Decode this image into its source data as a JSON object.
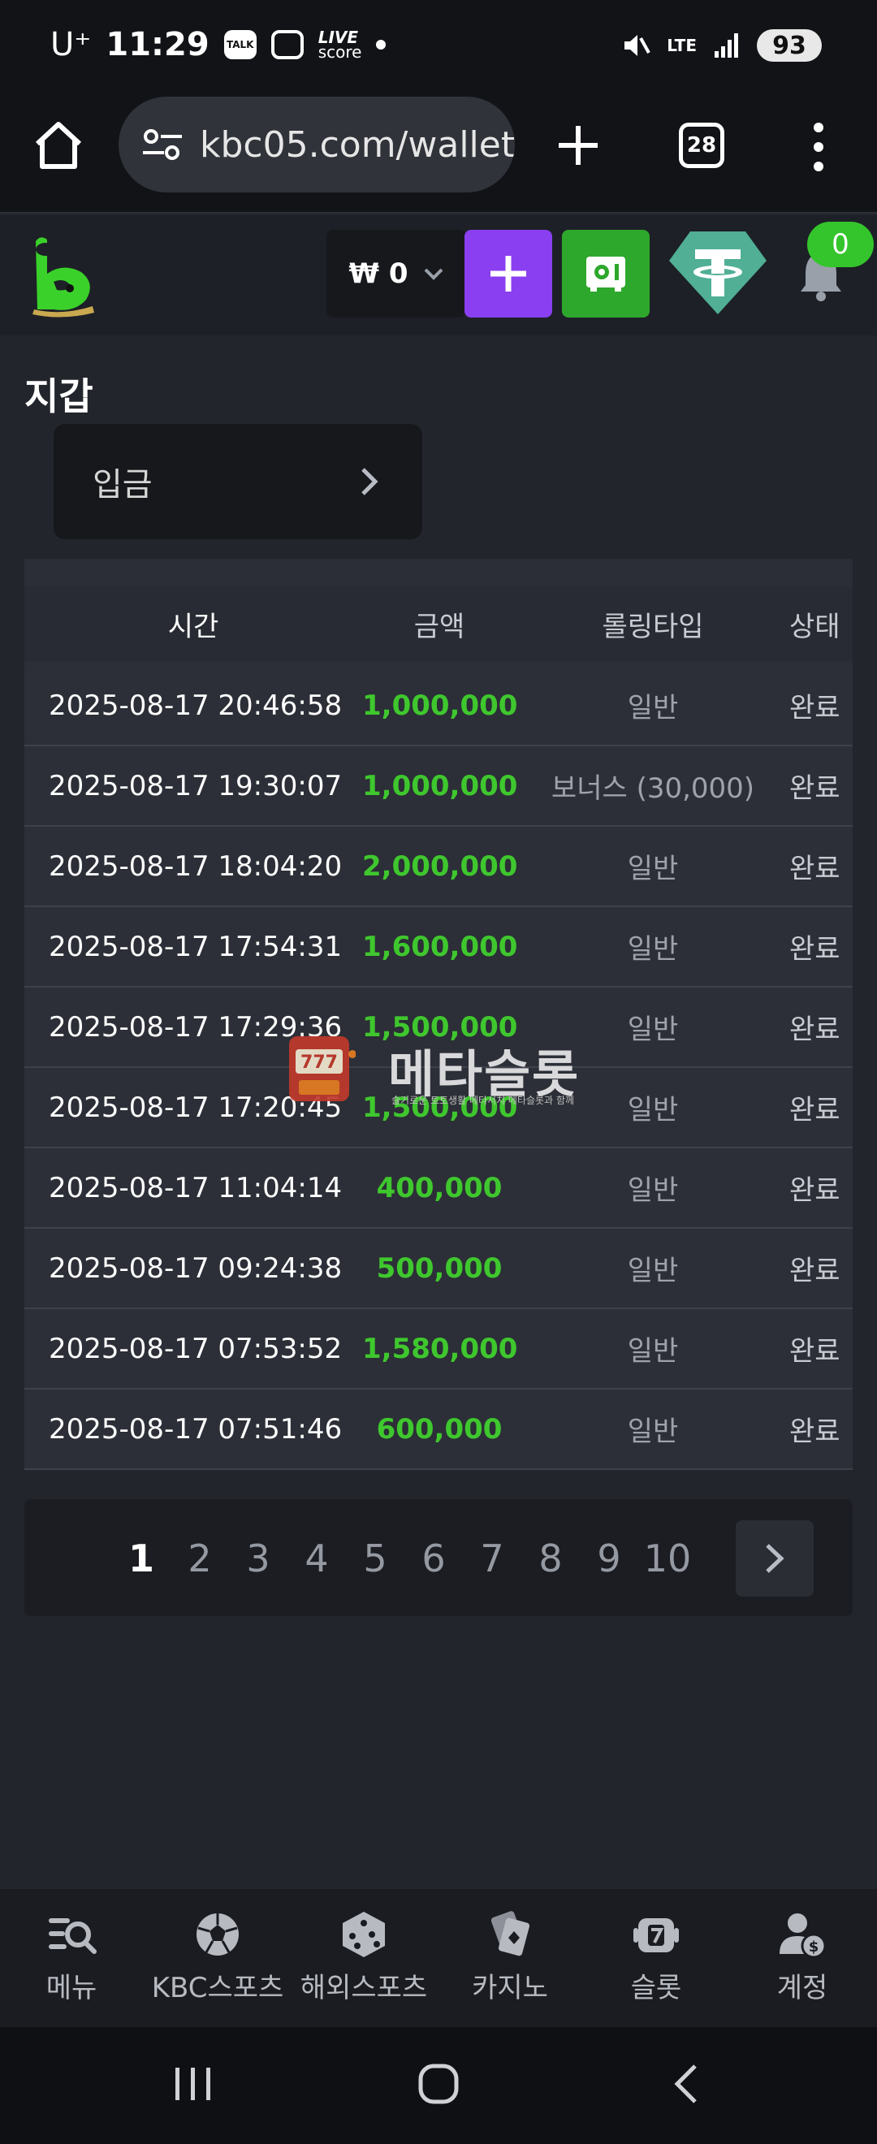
{
  "status_bar": {
    "carrier": "U⁺",
    "time": "11:29",
    "talk_badge": "TALK",
    "live_line1": "LIVE",
    "live_line2": "score",
    "network": "LTE",
    "battery": "93"
  },
  "browser": {
    "url": "kbc05.com/wallet",
    "tab_count": "28"
  },
  "header": {
    "balance": "₩ 0",
    "notification_count": "0"
  },
  "page": {
    "title": "지갑",
    "deposit_label": "입금"
  },
  "table": {
    "headers": [
      "시간",
      "금액",
      "롤링타입",
      "상태"
    ],
    "rows": [
      {
        "time": "2025-08-17 20:46:58",
        "amount": "1,000,000",
        "type": "일반",
        "status": "완료"
      },
      {
        "time": "2025-08-17 19:30:07",
        "amount": "1,000,000",
        "type": "보너스 (30,000)",
        "status": "완료"
      },
      {
        "time": "2025-08-17 18:04:20",
        "amount": "2,000,000",
        "type": "일반",
        "status": "완료"
      },
      {
        "time": "2025-08-17 17:54:31",
        "amount": "1,600,000",
        "type": "일반",
        "status": "완료"
      },
      {
        "time": "2025-08-17 17:29:36",
        "amount": "1,500,000",
        "type": "일반",
        "status": "완료"
      },
      {
        "time": "2025-08-17 17:20:45",
        "amount": "1,500,000",
        "type": "일반",
        "status": "완료"
      },
      {
        "time": "2025-08-17 11:04:14",
        "amount": "400,000",
        "type": "일반",
        "status": "완료"
      },
      {
        "time": "2025-08-17 09:24:38",
        "amount": "500,000",
        "type": "일반",
        "status": "완료"
      },
      {
        "time": "2025-08-17 07:53:52",
        "amount": "1,580,000",
        "type": "일반",
        "status": "완료"
      },
      {
        "time": "2025-08-17 07:51:46",
        "amount": "600,000",
        "type": "일반",
        "status": "완료"
      }
    ]
  },
  "watermark": {
    "title": "메타슬롯",
    "subtitle": "슬기로운 토토생활 메타서치 메타슬롯과 함께",
    "badge": "777"
  },
  "pagination": {
    "pages": [
      "1",
      "2",
      "3",
      "4",
      "5",
      "6",
      "7",
      "8",
      "9",
      "10"
    ],
    "current": "1"
  },
  "bottom_nav": [
    {
      "label": "메뉴",
      "icon": "menu-search-icon"
    },
    {
      "label": "KBC스포츠",
      "icon": "soccer-ball-icon"
    },
    {
      "label": "해외스포츠",
      "icon": "dice-icon"
    },
    {
      "label": "카지노",
      "icon": "cards-icon"
    },
    {
      "label": "슬롯",
      "icon": "slot-icon"
    },
    {
      "label": "계정",
      "icon": "account-icon"
    }
  ],
  "colors": {
    "accent_green": "#3fc72e",
    "purple": "#8a3ff0",
    "wallet_green": "#2ea82c",
    "tether": "#50af95"
  }
}
